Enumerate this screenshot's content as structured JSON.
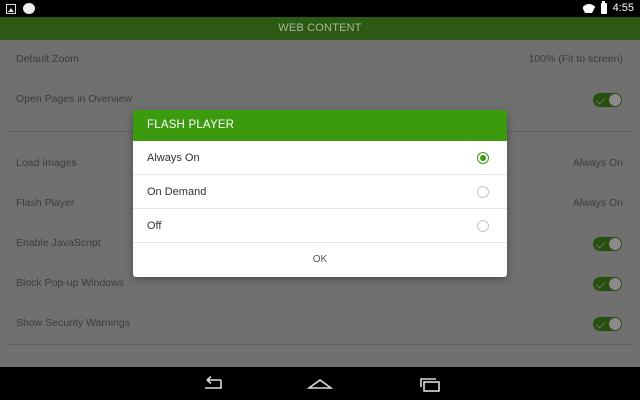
{
  "status_bar": {
    "time": "4:55"
  },
  "app": {
    "title": "WEB CONTENT",
    "settings": [
      {
        "label": "Default Zoom",
        "value": "100% (Fit to screen)"
      },
      {
        "label": "Open Pages in Overview",
        "toggle": true
      },
      {
        "label": "Load Images",
        "value": "Always On"
      },
      {
        "label": "Flash Player",
        "value": "Always On"
      },
      {
        "label": "Enable JavaScript",
        "toggle": true
      },
      {
        "label": "Block Pop-up Windows",
        "toggle": true
      },
      {
        "label": "Show Security Warnings",
        "toggle": true
      }
    ]
  },
  "dialog": {
    "title": "FLASH PLAYER",
    "options": [
      {
        "label": "Always On",
        "selected": true
      },
      {
        "label": "On Demand",
        "selected": false
      },
      {
        "label": "Off",
        "selected": false
      }
    ],
    "ok_label": "OK"
  },
  "colors": {
    "accent": "#3c9a0e",
    "dim_background": "#707070",
    "header_dim": "#2c5a13"
  },
  "icons": {
    "status": [
      "image-icon",
      "app-notification-icon",
      "wifi-icon",
      "battery-icon"
    ],
    "nav": [
      "back-icon",
      "home-icon",
      "recents-icon"
    ]
  }
}
